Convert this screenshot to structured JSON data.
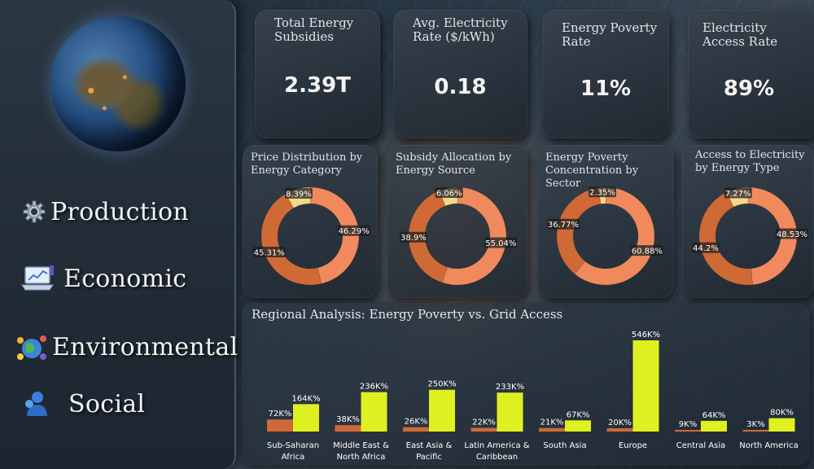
{
  "sidebar": {
    "items": [
      {
        "label": "Production",
        "icon": "gear-icon"
      },
      {
        "label": "Economic",
        "icon": "laptop-chart-icon"
      },
      {
        "label": "Environmental",
        "icon": "globe-people-icon"
      },
      {
        "label": "Social",
        "icon": "person-icon"
      }
    ]
  },
  "kpis": [
    {
      "title": "Total Energy Subsidies",
      "value": "2.39T"
    },
    {
      "title": "Avg. Electricity Rate ($/kWh)",
      "value": "0.18"
    },
    {
      "title": "Energy Poverty Rate",
      "value": "11%"
    },
    {
      "title": "Electricity Access Rate",
      "value": "89%"
    }
  ],
  "colors": {
    "dark_orange": "#cf6a36",
    "light_orange": "#f08a5d",
    "cream": "#f5d98a",
    "lime": "#dff021"
  },
  "chart_data": [
    {
      "type": "pie",
      "title": "Price Distribution by Energy Category",
      "values": [
        46.29,
        45.31,
        8.39
      ],
      "labels": [
        "46.29%",
        "45.31%",
        "8.39%"
      ],
      "colors": [
        "#f08a5d",
        "#cf6a36",
        "#f5d98a"
      ]
    },
    {
      "type": "pie",
      "title": "Subsidy Allocation by Energy Source",
      "values": [
        55.04,
        38.9,
        6.06
      ],
      "labels": [
        "55.04%",
        "38.9%",
        "6.06%"
      ],
      "colors": [
        "#f08a5d",
        "#cf6a36",
        "#f5d98a"
      ]
    },
    {
      "type": "pie",
      "title": "Energy Poverty Concentration by Sector",
      "values": [
        60.88,
        36.77,
        2.35
      ],
      "labels": [
        "60.88%",
        "36.77%",
        "2.35%"
      ],
      "colors": [
        "#f08a5d",
        "#cf6a36",
        "#f5d98a"
      ]
    },
    {
      "type": "pie",
      "title": "Access to Electricity by Energy Type",
      "values": [
        48.53,
        44.2,
        7.27
      ],
      "labels": [
        "48.53%",
        "44.2%",
        "7.27%"
      ],
      "colors": [
        "#f08a5d",
        "#cf6a36",
        "#f5d98a"
      ]
    },
    {
      "type": "bar",
      "title": "Regional Analysis: Energy Poverty vs. Grid Access",
      "categories": [
        "Sub-Saharan Africa",
        "Middle East & North Africa",
        "East Asia & Pacific",
        "Latin America & Caribbean",
        "South Asia",
        "Europe",
        "Central Asia",
        "North America"
      ],
      "series": [
        {
          "values": [
            72,
            38,
            26,
            22,
            21,
            20,
            9,
            3
          ],
          "labels": [
            "72K%",
            "38K%",
            "26K%",
            "22K%",
            "21K%",
            "20K%",
            "9K%",
            "3K%"
          ],
          "color": "#cf6a36"
        },
        {
          "values": [
            164,
            236,
            250,
            233,
            67,
            546,
            64,
            80
          ],
          "labels": [
            "164K%",
            "236K%",
            "250K%",
            "233K%",
            "67K%",
            "546K%",
            "64K%",
            "80K%"
          ],
          "color": "#dff021"
        }
      ]
    }
  ]
}
